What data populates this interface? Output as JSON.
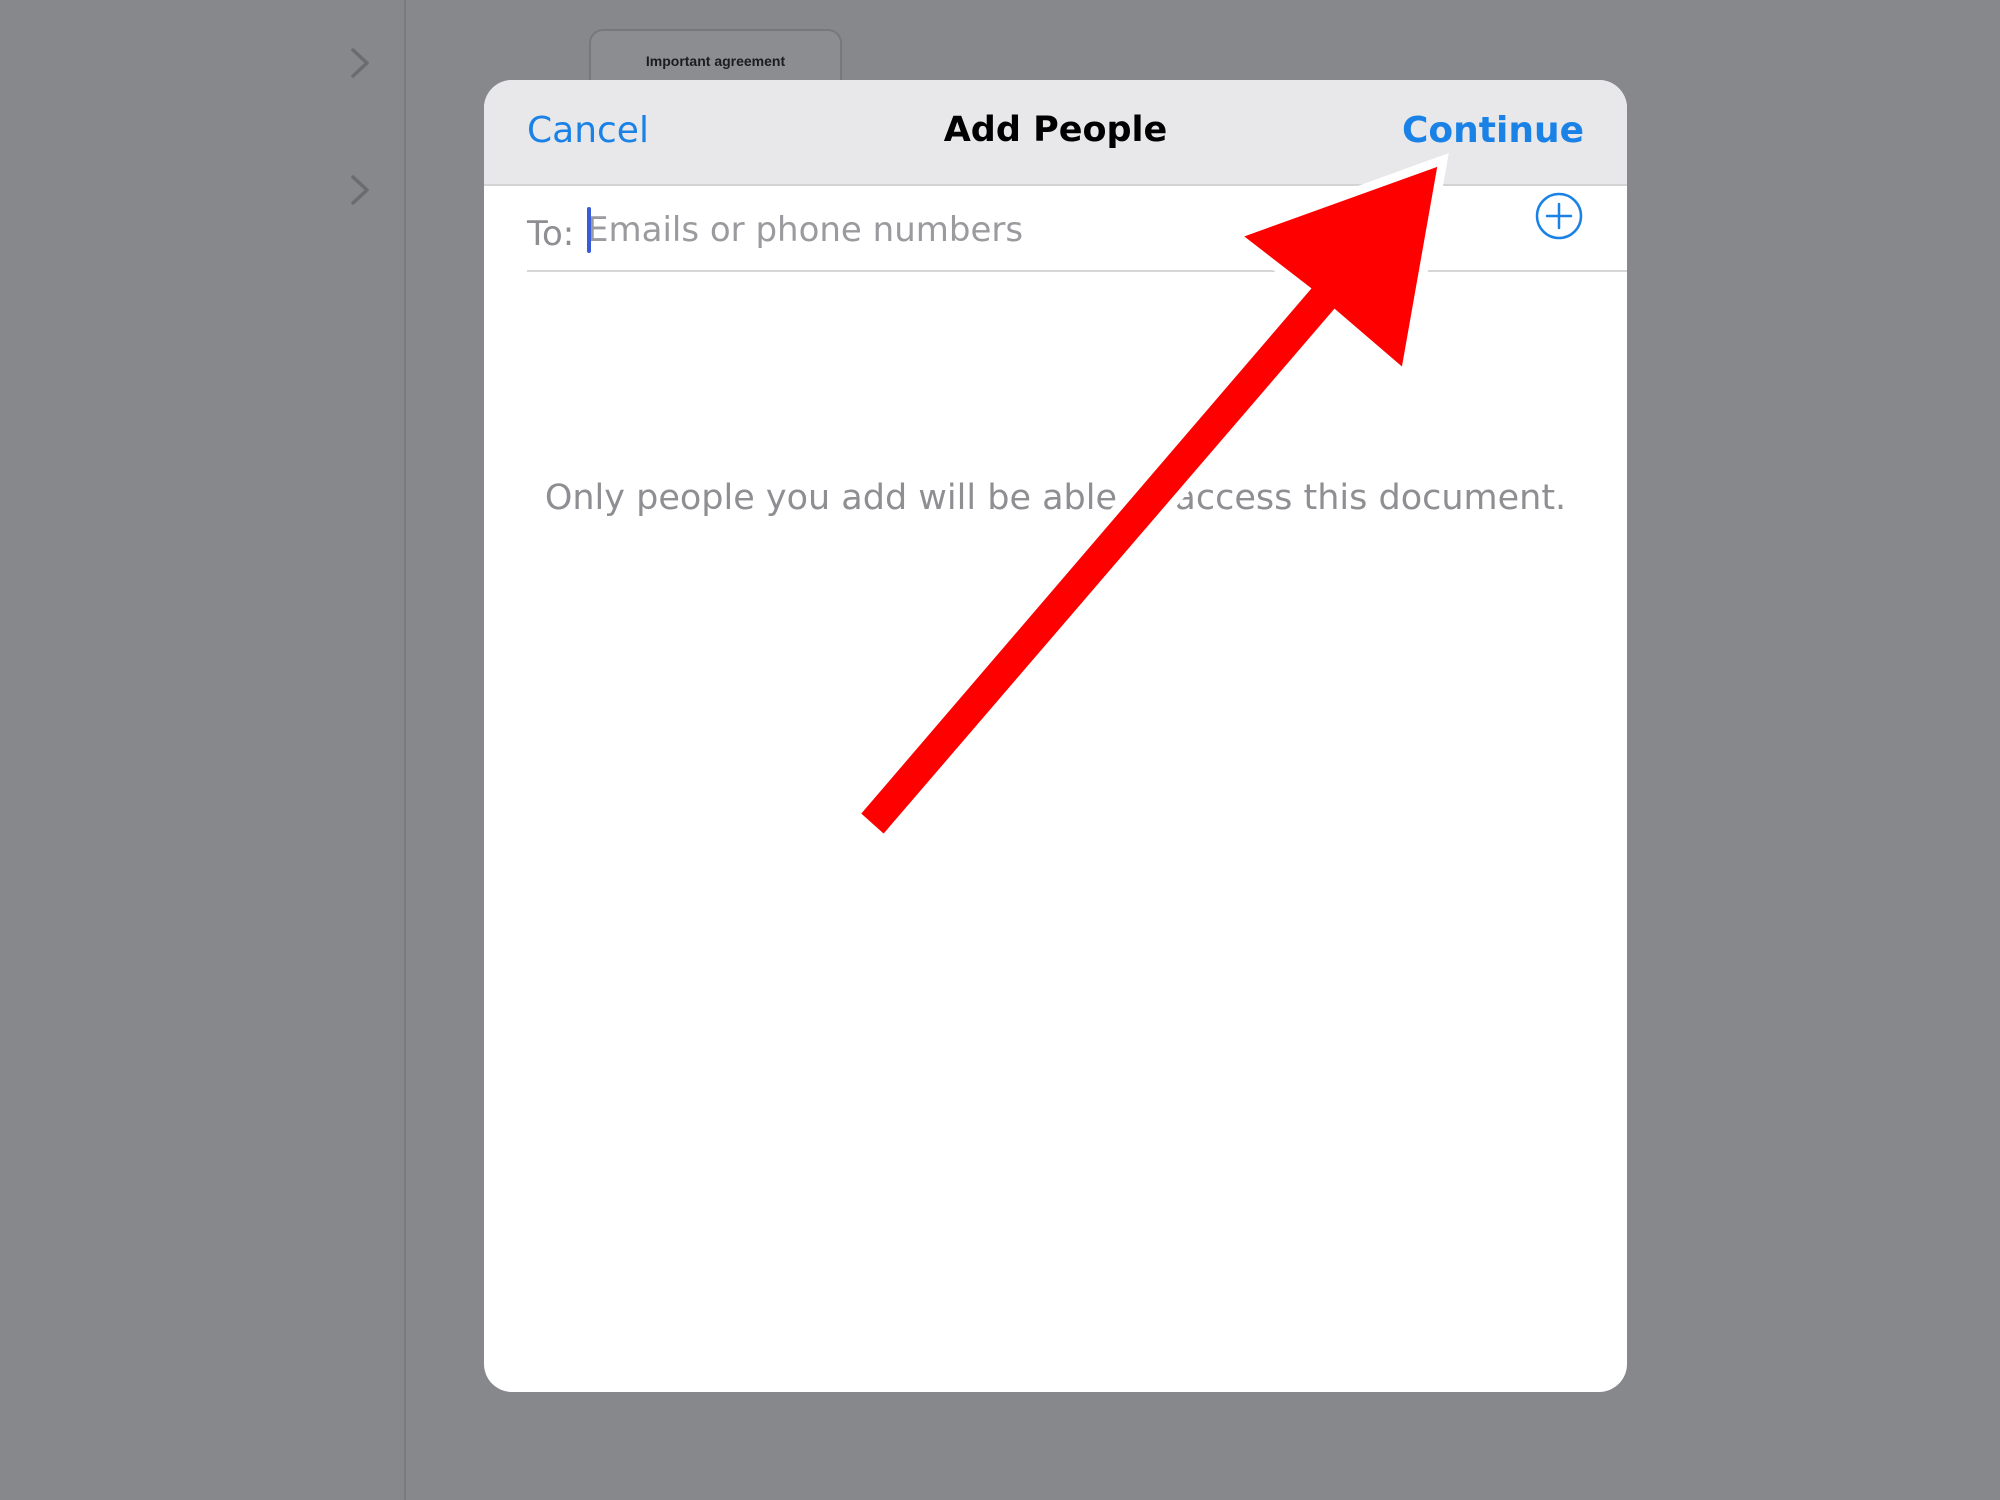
{
  "background": {
    "document_thumbnail_title": "Important agreement",
    "chevron_icon": "chevron-right-icon"
  },
  "modal": {
    "nav": {
      "cancel_label": "Cancel",
      "title": "Add People",
      "continue_label": "Continue"
    },
    "recipients": {
      "label": "To:",
      "value": "",
      "placeholder": "Emails or phone numbers",
      "add_icon": "plus-circle-icon"
    },
    "hint": "Only people you add will be able to access this document."
  },
  "annotation": {
    "type": "arrow",
    "color": "#ff0000",
    "outline_color": "#ffffff",
    "points_to": "continue-button"
  },
  "colors": {
    "accent": "#1a82e6",
    "caret": "#3a5bd9",
    "dim_background": "#87888b",
    "nav_background": "#e8e8ea"
  }
}
